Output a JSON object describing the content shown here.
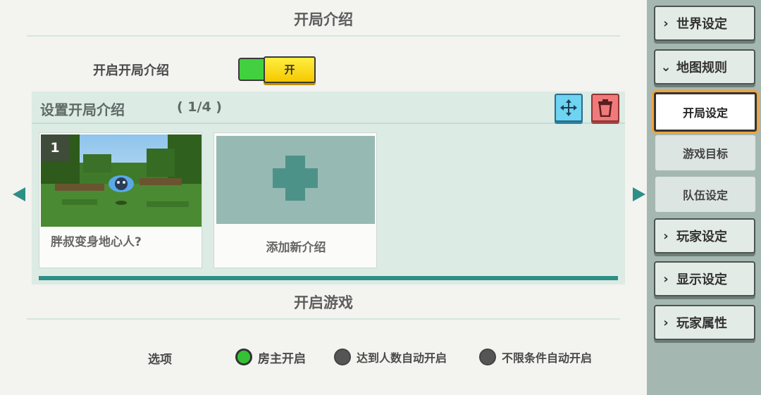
{
  "colors": {
    "accent": "#2e8f86",
    "toggle_on": "#43d040",
    "toggle_knob": "#f5c800",
    "move_button": "#6fd3f2",
    "delete_button": "#f07a7a",
    "sidebar_bg": "#a5b7b1",
    "active_outline": "#f0a43a"
  },
  "intro": {
    "section_title": "开局介绍",
    "enable_label": "开启开局介绍",
    "toggle_label": "开",
    "toggle_on": true
  },
  "panel": {
    "title": "设置开局介绍",
    "count": "( 1/4 )",
    "move_icon": "move-arrows-icon",
    "delete_icon": "trash-icon"
  },
  "cards": [
    {
      "number": "1",
      "caption": "胖叔变身地心人?"
    }
  ],
  "add_card": {
    "caption": "添加新介绍",
    "icon": "plus-icon"
  },
  "start_game": {
    "section_title": "开启游戏",
    "option_label": "选项",
    "options": [
      {
        "label": "房主开启",
        "selected": true
      },
      {
        "label": "达到人数自动开启",
        "selected": false
      },
      {
        "label": "不限条件自动开启",
        "selected": false
      }
    ]
  },
  "sidebar": {
    "items": [
      {
        "label": "世界设定",
        "chevron": "›"
      },
      {
        "label": "地图规则",
        "chevron": "⌄"
      },
      {
        "label": "开局设定",
        "active": true
      },
      {
        "label": "游戏目标"
      },
      {
        "label": "队伍设定"
      },
      {
        "label": "玩家设定",
        "chevron": "›"
      },
      {
        "label": "显示设定",
        "chevron": "›"
      },
      {
        "label": "玩家属性",
        "chevron": "›"
      }
    ]
  }
}
